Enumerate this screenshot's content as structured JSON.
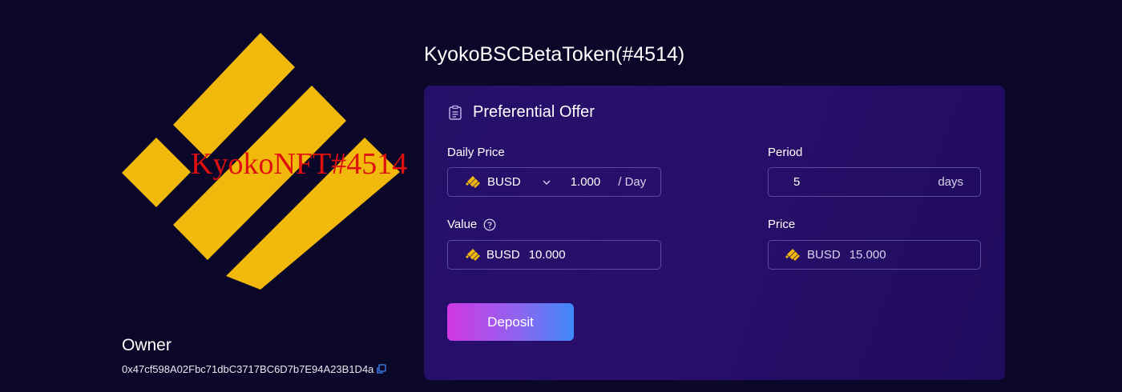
{
  "nft": {
    "overlay_text": "KyokoNFT#4514",
    "owner_label": "Owner",
    "owner_address": "0x47cf598A02Fbc71dbC3717BC6D7b7E94A23B1D4a"
  },
  "token_title": "KyokoBSCBetaToken(#4514)",
  "offer": {
    "title": "Preferential Offer",
    "daily_price": {
      "label": "Daily Price",
      "currency": "BUSD",
      "amount": "1.000",
      "unit": "/ Day"
    },
    "period": {
      "label": "Period",
      "value": "5",
      "unit": "days"
    },
    "value": {
      "label": "Value",
      "currency": "BUSD",
      "amount": "10.000"
    },
    "price": {
      "label": "Price",
      "currency": "BUSD",
      "amount": "15.000"
    },
    "deposit_label": "Deposit"
  },
  "colors": {
    "background": "#0b0728",
    "card": "#241068",
    "binance_yellow": "#f0b90b",
    "overlay_red": "#e01010",
    "accent_blue": "#3f8af8",
    "accent_magenta": "#d037e4"
  },
  "icons": {
    "nft_image": "binance-logo",
    "card_header": "clipboard-icon",
    "currency": "busd-coin-icon",
    "dropdown": "chevron-down-icon",
    "help": "question-circle-icon",
    "copy": "copy-icon"
  }
}
